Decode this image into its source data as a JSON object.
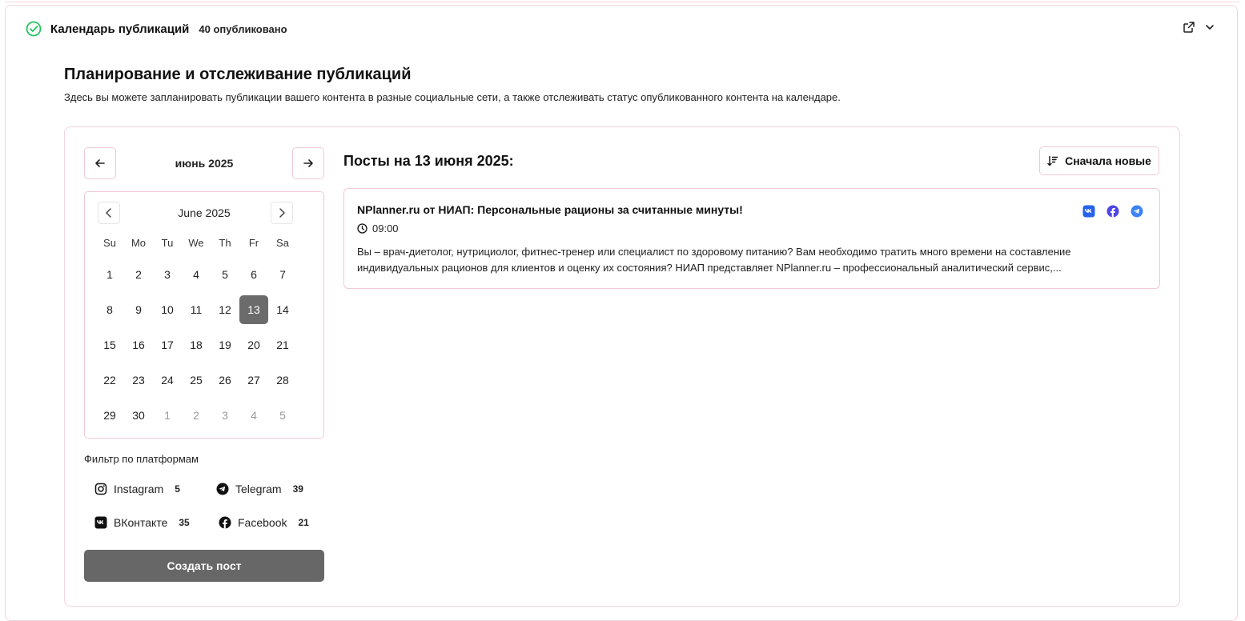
{
  "header": {
    "title": "Календарь публикаций",
    "count": "40 опубликовано"
  },
  "page": {
    "heading": "Планирование и отслеживание публикаций",
    "description": "Здесь вы можете запланировать публикации вашего контента в разные социальные сети, а также отслеживать статус опубликованного контента на календаре."
  },
  "month_nav": {
    "label": "июнь 2025"
  },
  "calendar": {
    "title": "June 2025",
    "weekdays": [
      "Su",
      "Mo",
      "Tu",
      "We",
      "Th",
      "Fr",
      "Sa"
    ],
    "selected_day": "13",
    "weeks": [
      [
        "1",
        "2",
        "3",
        "4",
        "5",
        "6",
        "7"
      ],
      [
        "8",
        "9",
        "10",
        "11",
        "12",
        "13",
        "14"
      ],
      [
        "15",
        "16",
        "17",
        "18",
        "19",
        "20",
        "21"
      ],
      [
        "22",
        "23",
        "24",
        "25",
        "26",
        "27",
        "28"
      ],
      [
        "29",
        "30",
        "1",
        "2",
        "3",
        "4",
        "5"
      ]
    ]
  },
  "filter": {
    "label": "Фильтр по платформам",
    "platforms": [
      {
        "name": "Instagram",
        "count": "5",
        "icon": "instagram-icon"
      },
      {
        "name": "Telegram",
        "count": "39",
        "icon": "telegram-icon"
      },
      {
        "name": "ВКонтакте",
        "count": "35",
        "icon": "vk-icon"
      },
      {
        "name": "Facebook",
        "count": "21",
        "icon": "facebook-icon"
      }
    ]
  },
  "create_button": "Создать пост",
  "posts": {
    "heading": "Посты на 13 июня 2025:",
    "sort_label": "Сначала новые",
    "items": [
      {
        "title": "NPlanner.ru от НИАП: Персональные рационы за считанные минуты!",
        "time": "09:00",
        "body": "Вы – врач-диетолог, нутрициолог, фитнес-тренер или специалист по здоровому питанию? Вам необходимо тратить много времени на составление индивидуальных рационов для клиентов и оценку их состояния? НИАП представляет NPlanner.ru – профессиональный аналитический сервис,...",
        "platforms": [
          "vk-icon",
          "facebook-icon",
          "telegram-icon"
        ]
      }
    ]
  },
  "colors": {
    "accent_border": "#f0c9d3",
    "selected_day": "#6b6b6b",
    "check_green": "#22c55e",
    "vk": "#2563eb",
    "facebook": "#4f46e5",
    "telegram": "#3b82f6"
  }
}
